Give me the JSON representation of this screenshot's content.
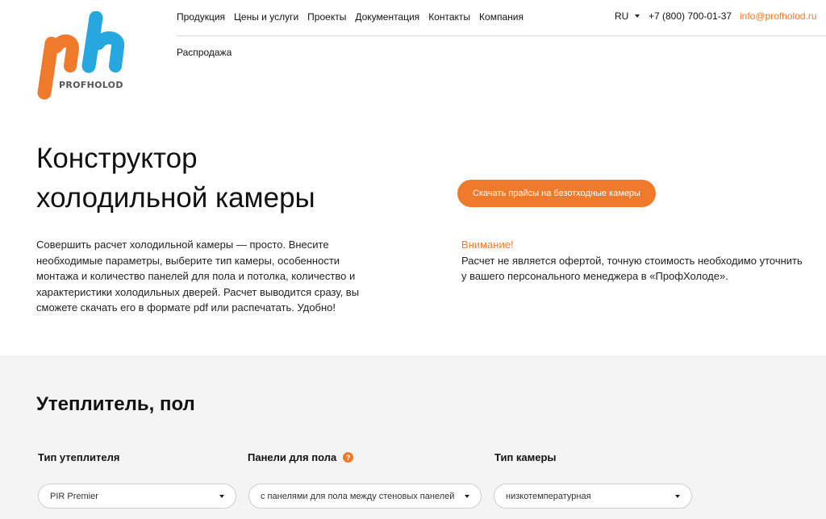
{
  "brand": {
    "logo_text": "PROFHOLOD",
    "colors": {
      "orange": "#f07a2b",
      "blue": "#27a7e0"
    }
  },
  "nav": {
    "items": [
      "Продукция",
      "Цены и услуги",
      "Проекты",
      "Документация",
      "Контакты",
      "Компания"
    ],
    "sub_item": "Распродажа",
    "lang": "RU",
    "phone": "+7 (800) 700-01-37",
    "email": "info@profholod.ru"
  },
  "hero": {
    "title_line1": "Конструктор",
    "title_line2": "холодильной камеры",
    "cta_label": "Скачать прайсы на безотходные камеры",
    "intro": "Совершить расчет холодильной камеры — просто. Внесите необходимые параметры, выберите тип камеры, особенности монтажа и количество панелей для пола и потолка, количество и характеристики холодильных дверей. Расчет выводится сразу, вы сможете скачать его в формате pdf или распечатать. Удобно!",
    "notice_title": "Внимание!",
    "notice_text": "Расчет не является офертой, точную стоимость необходимо уточнить у вашего персонального менеджера в «ПрофХолоде»."
  },
  "section": {
    "title": "Утеплитель, пол",
    "fields": [
      {
        "label": "Тип утеплителя",
        "value": "PIR Premier",
        "has_help": false
      },
      {
        "label": "Панели для пола",
        "value": "с панелями для пола между стеновых панелей",
        "has_help": true
      },
      {
        "label": "Тип камеры",
        "value": "низкотемпературная",
        "has_help": false
      }
    ],
    "help_icon_glyph": "?"
  }
}
